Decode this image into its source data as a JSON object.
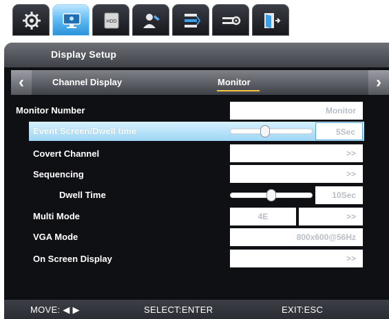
{
  "tabs": [
    {
      "icon": "gear-icon",
      "active": false
    },
    {
      "icon": "monitor-icon",
      "active": true
    },
    {
      "icon": "hdd-icon",
      "active": false,
      "text": "HDD"
    },
    {
      "icon": "user-icon",
      "active": false
    },
    {
      "icon": "network-icon",
      "active": false
    },
    {
      "icon": "settings-slider-icon",
      "active": false
    },
    {
      "icon": "exit-door-icon",
      "active": false
    }
  ],
  "title": "Display Setup",
  "subtabs": {
    "left": "Channel Display",
    "right": "Monitor"
  },
  "rows": {
    "monitor_number": {
      "label": "Monitor Number",
      "value": "Monitor"
    },
    "event_screen": {
      "label": "Event Screen/Dwell time",
      "value": "5Sec",
      "slider_level": 0.42
    },
    "covert_channel": {
      "label": "Covert Channel",
      "value": ">>"
    },
    "sequencing": {
      "label": "Sequencing",
      "value": ">>"
    },
    "dwell_time": {
      "label": "Dwell Time",
      "value": "10Sec",
      "slider_level": 0.5
    },
    "multi_mode": {
      "label": "Multi Mode",
      "value": "4E",
      "value2": ">>"
    },
    "vga_mode": {
      "label": "VGA Mode",
      "value": "800x600@56Hz"
    },
    "on_screen_display": {
      "label": "On Screen Display",
      "value": ">>"
    }
  },
  "footer": {
    "move": "MOVE: ◀ ▶",
    "select": "SELECT:ENTER",
    "exit": "EXIT:ESC"
  },
  "colors": {
    "accent": "#2a92d8",
    "highlight": "#9dd6f4",
    "underline": "#f5c542",
    "panel": "#0f1014"
  }
}
